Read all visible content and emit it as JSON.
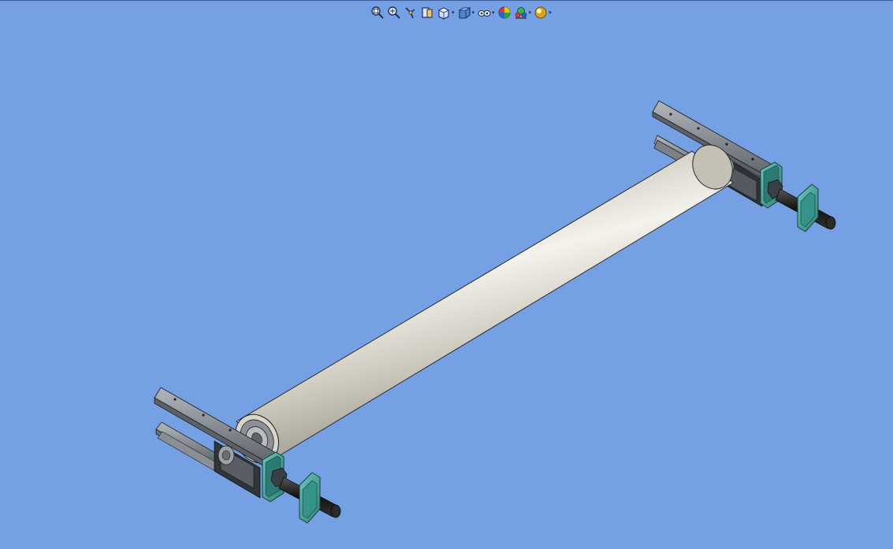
{
  "window": {
    "background": "#76a0e4"
  },
  "toolbar": {
    "buttons": [
      {
        "name": "zoom-to-fit-icon",
        "dropdown": false
      },
      {
        "name": "zoom-to-area-icon",
        "dropdown": false
      },
      {
        "name": "previous-view-icon",
        "dropdown": false
      },
      {
        "name": "section-view-icon",
        "dropdown": false
      },
      {
        "name": "view-orientation-icon",
        "dropdown": true
      },
      {
        "name": "display-style-icon",
        "dropdown": true
      },
      {
        "name": "hide-show-items-icon",
        "dropdown": true
      },
      {
        "name": "edit-appearance-icon",
        "dropdown": false
      },
      {
        "name": "apply-scene-icon",
        "dropdown": true
      },
      {
        "name": "view-settings-icon",
        "dropdown": true
      }
    ],
    "dropdown_glyph": "▾"
  },
  "model": {
    "roller_color": "#d2cfc6",
    "bracket_color": "#8e949c",
    "bearing_block_color": "#4aa79f",
    "shaft_color": "#1e1e1e"
  }
}
